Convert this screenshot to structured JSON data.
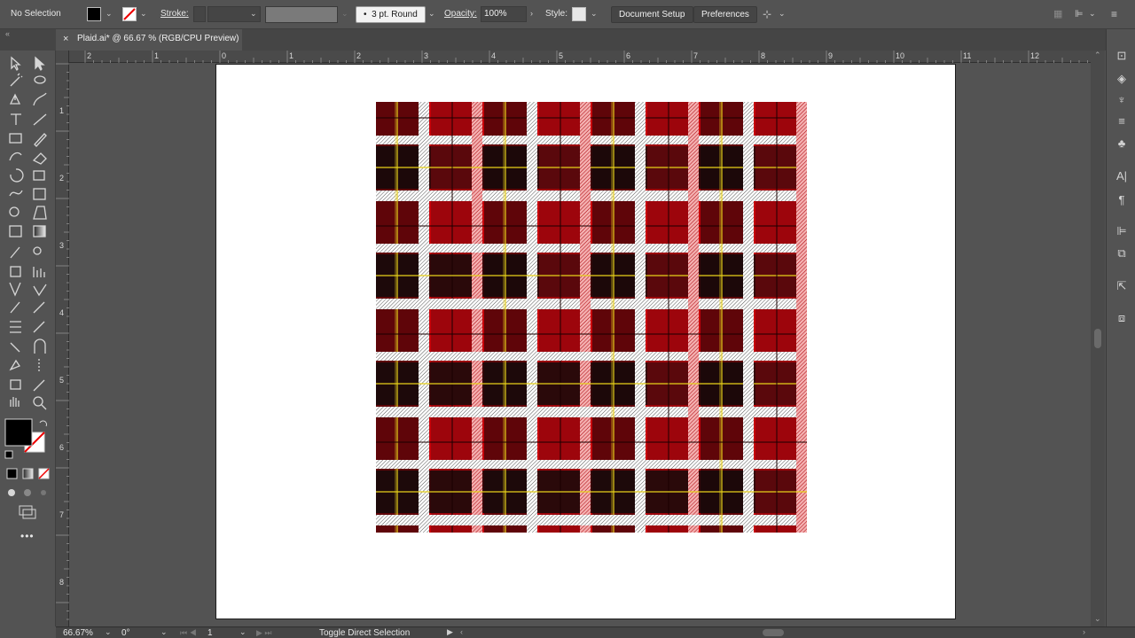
{
  "control_bar": {
    "selection_status": "No Selection",
    "stroke_label": "Stroke:",
    "brush_label": "3 pt. Round",
    "opacity_label": "Opacity:",
    "opacity_value": "100%",
    "style_label": "Style:",
    "document_setup": "Document Setup",
    "preferences": "Preferences"
  },
  "tab": {
    "close": "×",
    "title": "Plaid.ai* @ 66.67 % (RGB/CPU Preview)"
  },
  "ruler_top": [
    "2",
    "1",
    "0",
    "1",
    "2",
    "3",
    "4",
    "5",
    "6",
    "7",
    "8",
    "9",
    "10",
    "11",
    "12"
  ],
  "ruler_left": [
    "1",
    "2",
    "3",
    "4",
    "5",
    "6",
    "7",
    "8"
  ],
  "status_bar": {
    "zoom": "66.67%",
    "rotation": "0°",
    "artboard_number": "1",
    "tool_hint": "Toggle Direct Selection"
  },
  "colors": {
    "plaid_red": "#c8000a",
    "plaid_dark_red": "#7a0a0e",
    "plaid_black": "#0a0a0a",
    "plaid_white": "#ffffff",
    "plaid_yellow": "#e8d21a",
    "ui_bg": "#535353"
  },
  "icons": {
    "more_tools": "•••"
  }
}
